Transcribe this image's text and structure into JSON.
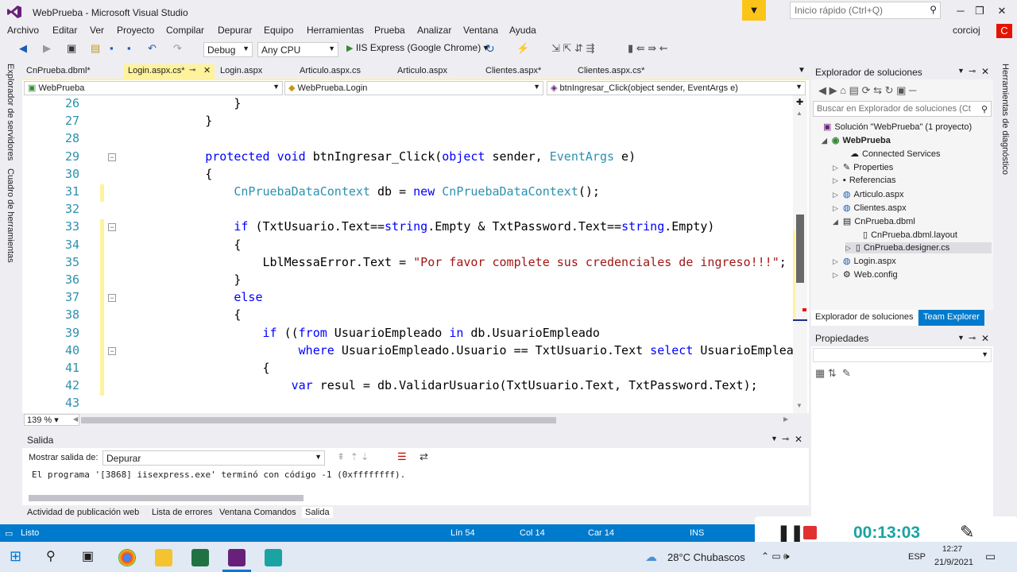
{
  "window": {
    "title": "WebPrueba - Microsoft Visual Studio",
    "quick_launch_placeholder": "Inicio rápido (Ctrl+Q)",
    "user": "corcioj",
    "user_badge": "C"
  },
  "menu": [
    "Archivo",
    "Editar",
    "Ver",
    "Proyecto",
    "Compilar",
    "Depurar",
    "Equipo",
    "Herramientas",
    "Prueba",
    "Analizar",
    "Ventana",
    "Ayuda"
  ],
  "toolbar": {
    "configuration": "Debug",
    "platform": "Any CPU",
    "run_label": "IIS Express (Google Chrome)"
  },
  "left_strip": [
    "Explorador de servidores",
    "Cuadro de herramientas"
  ],
  "right_strip": "Herramientas de diagnóstico",
  "tabs": [
    "CnPrueba.dbml*",
    "Login.aspx.cs*",
    "Login.aspx",
    "Articulo.aspx.cs",
    "Articulo.aspx",
    "Clientes.aspx*",
    "Clientes.aspx.cs*"
  ],
  "active_tab": "Login.aspx.cs*",
  "navbar": {
    "project": "WebPrueba",
    "class": "WebPrueba.Login",
    "member": "btnIngresar_Click(object sender, EventArgs e)"
  },
  "editor": {
    "zoom": "139 %",
    "line_numbers": [
      "26",
      "27",
      "28",
      "29",
      "30",
      "31",
      "32",
      "33",
      "34",
      "35",
      "36",
      "37",
      "38",
      "39",
      "40",
      "41",
      "42",
      "43"
    ],
    "lines": [
      {
        "indent": "            ",
        "tokens": [
          [
            "",
            "}"
          ]
        ]
      },
      {
        "indent": "        ",
        "tokens": [
          [
            "",
            "}"
          ]
        ]
      },
      {
        "indent": "",
        "tokens": []
      },
      {
        "indent": "        ",
        "tokens": [
          [
            "kw",
            "protected"
          ],
          [
            "",
            " "
          ],
          [
            "kw",
            "void"
          ],
          [
            "",
            " btnIngresar_Click("
          ],
          [
            "kw",
            "object"
          ],
          [
            "",
            " sender, "
          ],
          [
            "ty",
            "EventArgs"
          ],
          [
            "",
            " e)"
          ]
        ]
      },
      {
        "indent": "        ",
        "tokens": [
          [
            "",
            "{"
          ]
        ]
      },
      {
        "indent": "            ",
        "tokens": [
          [
            "ty",
            "CnPruebaDataContext"
          ],
          [
            "",
            " db = "
          ],
          [
            "kw",
            "new"
          ],
          [
            "",
            " "
          ],
          [
            "ty",
            "CnPruebaDataContext"
          ],
          [
            "",
            "();"
          ]
        ]
      },
      {
        "indent": "",
        "tokens": []
      },
      {
        "indent": "            ",
        "tokens": [
          [
            "kw",
            "if"
          ],
          [
            "",
            " (TxtUsuario.Text=="
          ],
          [
            "kw",
            "string"
          ],
          [
            "",
            ".Empty & TxtPassword.Text=="
          ],
          [
            "kw",
            "string"
          ],
          [
            "",
            ".Empty)"
          ]
        ]
      },
      {
        "indent": "            ",
        "tokens": [
          [
            "",
            "{"
          ]
        ]
      },
      {
        "indent": "                ",
        "tokens": [
          [
            "",
            "LblMessaError.Text = "
          ],
          [
            "st",
            "\"Por favor complete sus credenciales de ingreso!!!\""
          ],
          [
            "",
            ";"
          ]
        ]
      },
      {
        "indent": "            ",
        "tokens": [
          [
            "",
            "}"
          ]
        ]
      },
      {
        "indent": "            ",
        "tokens": [
          [
            "kw",
            "else"
          ]
        ]
      },
      {
        "indent": "            ",
        "tokens": [
          [
            "",
            "{"
          ]
        ]
      },
      {
        "indent": "                ",
        "tokens": [
          [
            "kw",
            "if"
          ],
          [
            "",
            " (("
          ],
          [
            "kw",
            "from"
          ],
          [
            "",
            " UsuarioEmpleado "
          ],
          [
            "kw",
            "in"
          ],
          [
            "",
            " db.UsuarioEmpleado"
          ]
        ]
      },
      {
        "indent": "                     ",
        "tokens": [
          [
            "kw",
            "where"
          ],
          [
            "",
            " UsuarioEmpleado.Usuario == TxtUsuario.Text "
          ],
          [
            "kw",
            "select"
          ],
          [
            "",
            " UsuarioEmpleado"
          ]
        ]
      },
      {
        "indent": "                ",
        "tokens": [
          [
            "",
            "{"
          ]
        ]
      },
      {
        "indent": "                    ",
        "tokens": [
          [
            "kw",
            "var"
          ],
          [
            "",
            " resul = db.ValidarUsuario(TxtUsuario.Text, TxtPassword.Text);"
          ]
        ]
      },
      {
        "indent": "",
        "tokens": []
      }
    ]
  },
  "output": {
    "title": "Salida",
    "show_label": "Mostrar salida de:",
    "source": "Depurar",
    "text": "El programa '[3868] iisexpress.exe' terminó con código -1 (0xffffffff)."
  },
  "bottom_tabs": [
    "Actividad de publicación web",
    "Lista de errores",
    "Ventana Comandos",
    "Salida"
  ],
  "solution_explorer": {
    "title": "Explorador de soluciones",
    "search_placeholder": "Buscar en Explorador de soluciones (Ct",
    "items": [
      "Solución \"WebPrueba\" (1 proyecto)",
      "WebPrueba",
      "Connected Services",
      "Properties",
      "Referencias",
      "Articulo.aspx",
      "Clientes.aspx",
      "CnPrueba.dbml",
      "CnPrueba.dbml.layout",
      "CnPrueba.designer.cs",
      "Login.aspx",
      "Web.config"
    ],
    "tabs": [
      "Explorador de soluciones",
      "Team Explorer"
    ]
  },
  "properties": {
    "title": "Propiedades"
  },
  "status": {
    "state": "Listo",
    "line": "Lín 54",
    "col": "Col 14",
    "char": "Car 14",
    "mode": "INS"
  },
  "recorder": {
    "time": "00:13:03"
  },
  "taskbar": {
    "weather": "28°C  Chubascos",
    "lang": "ESP",
    "time": "12:27",
    "date": "21/9/2021"
  }
}
